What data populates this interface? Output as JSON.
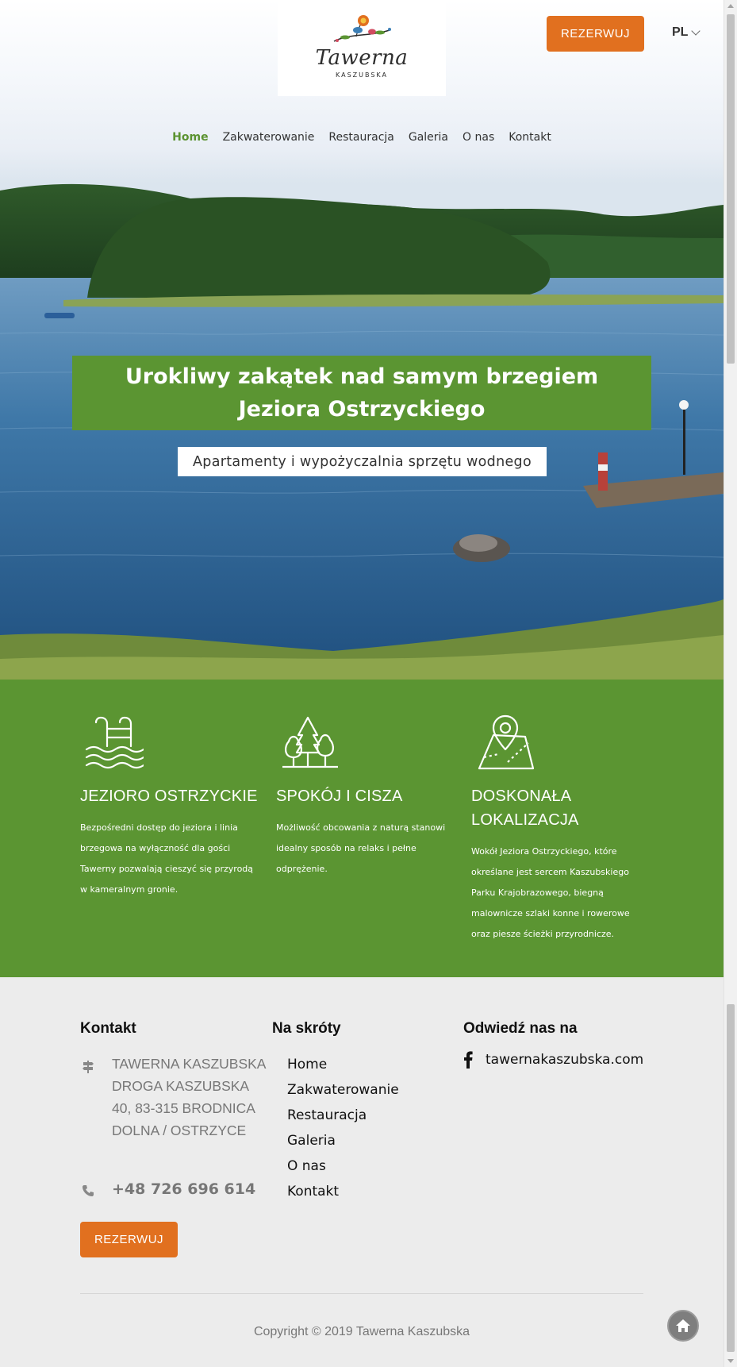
{
  "header": {
    "logo_title": "Tawerna",
    "logo_subtitle": "KASZUBSKA",
    "book_label": "REZERWUJ",
    "language": "PL"
  },
  "nav": {
    "items": [
      {
        "label": "Home",
        "active": true
      },
      {
        "label": "Zakwaterowanie",
        "active": false
      },
      {
        "label": "Restauracja",
        "active": false
      },
      {
        "label": "Galeria",
        "active": false
      },
      {
        "label": "O nas",
        "active": false
      },
      {
        "label": "Kontakt",
        "active": false
      }
    ]
  },
  "hero": {
    "headline": "Urokliwy zakątek nad samym brzegiem Jeziora Ostrzyckiego",
    "subheadline": "Apartamenty i wypożyczalnia sprzętu wodnego"
  },
  "features": [
    {
      "icon": "pool-ladder-icon",
      "title": "JEZIORO OSTRZYCKIE",
      "text": "Bezpośredni dostęp do jeziora i linia brzegowa na wyłączność dla gości Tawerny pozwalają cieszyć się przyrodą w kameralnym gronie."
    },
    {
      "icon": "trees-icon",
      "title": "SPOKÓJ I CISZA",
      "text": "Możliwość obcowania z naturą stanowi idealny sposób na relaks i pełne odprężenie."
    },
    {
      "icon": "map-pin-icon",
      "title": "DOSKONAŁA LOKALIZACJA",
      "text": "Wokół Jeziora Ostrzyckiego, które określane jest sercem Kaszubskiego Parku Krajobrazowego, biegną malownicze szlaki konne i rowerowe oraz piesze ścieżki przyrodnicze."
    }
  ],
  "footer": {
    "contact_title": "Kontakt",
    "address": "Tawerna Kaszubska Droga Kaszubska 40, 83-315 Brodnica Dolna / Ostrzyce",
    "phone": "+48 726 696 614",
    "book_label": "REZERWUJ",
    "shortcuts_title": "Na skróty",
    "shortcuts": [
      "Home",
      "Zakwaterowanie",
      "Restauracja",
      "Galeria",
      "O nas",
      "Kontakt"
    ],
    "visit_title": "Odwiedź nas na",
    "facebook": "tawernakaszubska.com",
    "copyright": "Copyright © 2019 Tawerna Kaszubska"
  },
  "colors": {
    "brand_green": "#5b9532",
    "accent_orange": "#e1701f",
    "footer_bg": "#ececec"
  }
}
